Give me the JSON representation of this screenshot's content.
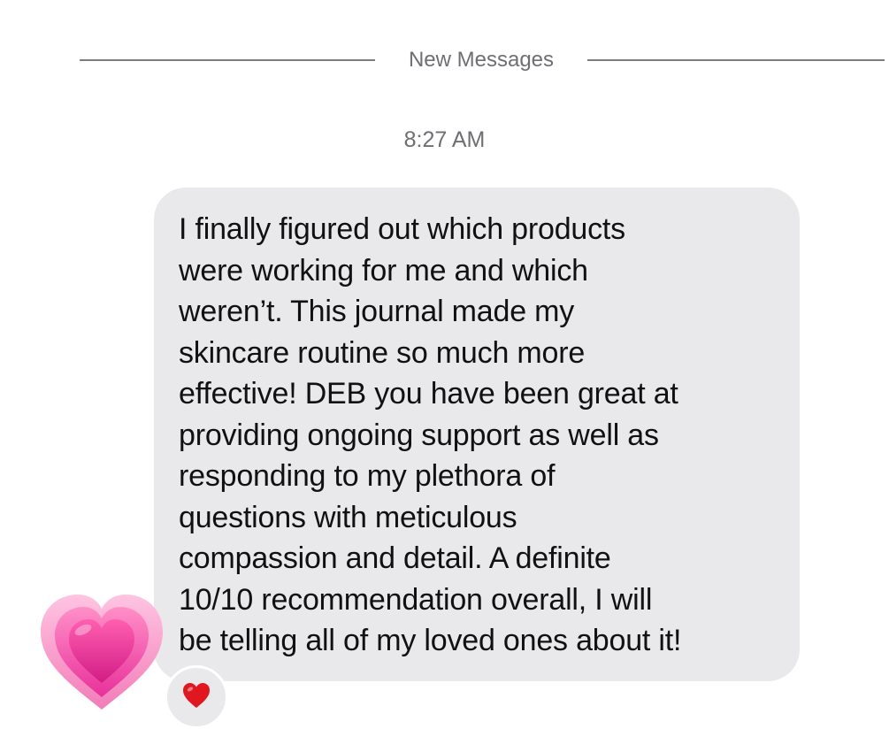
{
  "divider": {
    "label": "New Messages"
  },
  "thread": {
    "timestamp": "8:27 AM"
  },
  "message": {
    "lines": [
      "I finally figured out which products",
      "were working for me and which",
      "weren’t. This journal made my",
      "skincare routine so much more",
      "effective! DEB you have been great at",
      "providing ongoing support as well as",
      "responding to my plethora of",
      "questions with meticulous",
      "compassion and detail. A definite",
      "10/10 recommendation overall, I will",
      "be telling all of my loved ones about it!"
    ],
    "bubble_color": "#e9e9eb",
    "text_color": "#111111"
  },
  "sticker": {
    "icon": "growing-heart-icon",
    "color": "#f0449a"
  },
  "reaction": {
    "icon": "red-heart-icon",
    "color": "#e0171f"
  }
}
